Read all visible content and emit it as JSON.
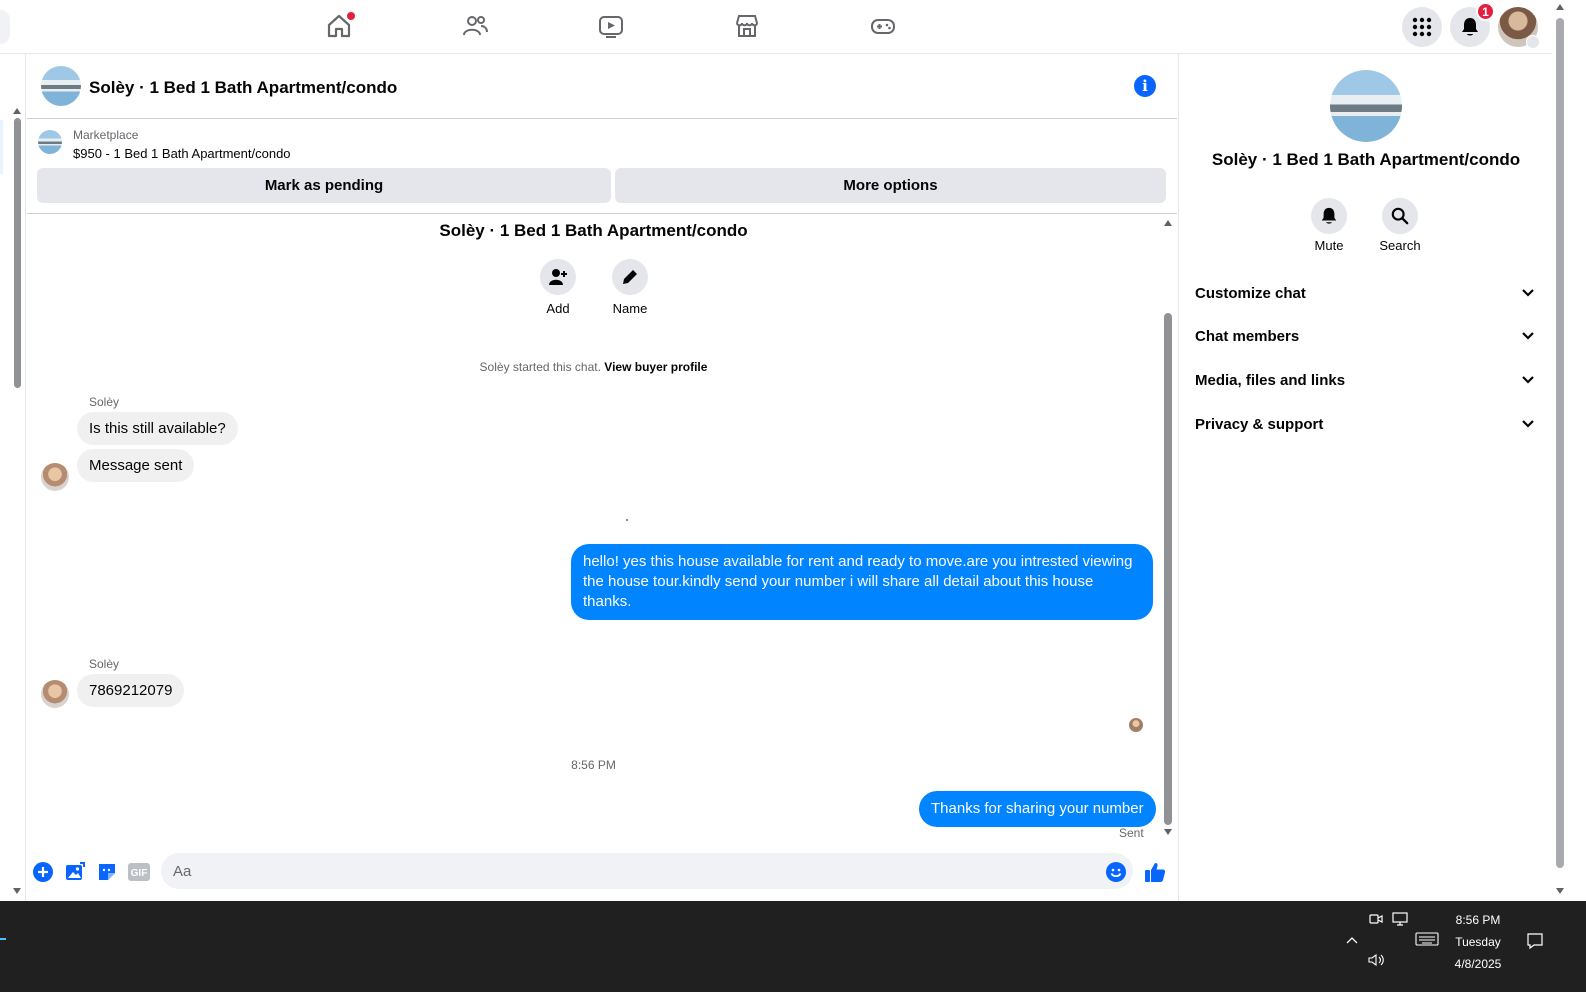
{
  "topnav": {
    "icons": [
      "home-icon",
      "friends-icon",
      "video-icon",
      "marketplace-icon",
      "gaming-icon"
    ],
    "notifications_count": "1"
  },
  "chat": {
    "title": "Solèy · 1 Bed 1 Bath Apartment/condo"
  },
  "marketplace": {
    "label": "Marketplace",
    "listing": "$950 - 1 Bed 1 Bath Apartment/condo",
    "mark_pending": "Mark as pending",
    "more_options": "More options"
  },
  "thread": {
    "title": "Solèy · 1 Bed 1 Bath Apartment/condo",
    "add_label": "Add",
    "name_label": "Name",
    "system_prefix": "Solèy started this chat.",
    "system_link": "View buyer profile",
    "messages": [
      {
        "sender": "Solèy",
        "text": "Is this still available?"
      },
      {
        "text": "Message sent"
      },
      {
        "text": "hello! yes this house available for rent and ready to move.are you intrested viewing the house tour.kindly send your number i will share all detail about this house thanks."
      },
      {
        "sender": "Solèy",
        "text": "7869212079"
      },
      {
        "text": "Thanks for sharing your number"
      }
    ],
    "timestamp": "8:56 PM",
    "status": "Sent"
  },
  "composer": {
    "placeholder": "Aa"
  },
  "rightpanel": {
    "title": "Solèy · 1 Bed 1 Bath Apartment/condo",
    "mute_label": "Mute",
    "search_label": "Search",
    "sections": [
      "Customize chat",
      "Chat members",
      "Media, files and links",
      "Privacy & support"
    ]
  },
  "taskbar": {
    "time": "8:56 PM",
    "day": "Tuesday",
    "date": "4/8/2025"
  },
  "colors": {
    "accent": "#0866ff",
    "bubble_out": "#0084ff",
    "bubble_in": "#f0f0f0",
    "badge": "#e41e3f"
  }
}
